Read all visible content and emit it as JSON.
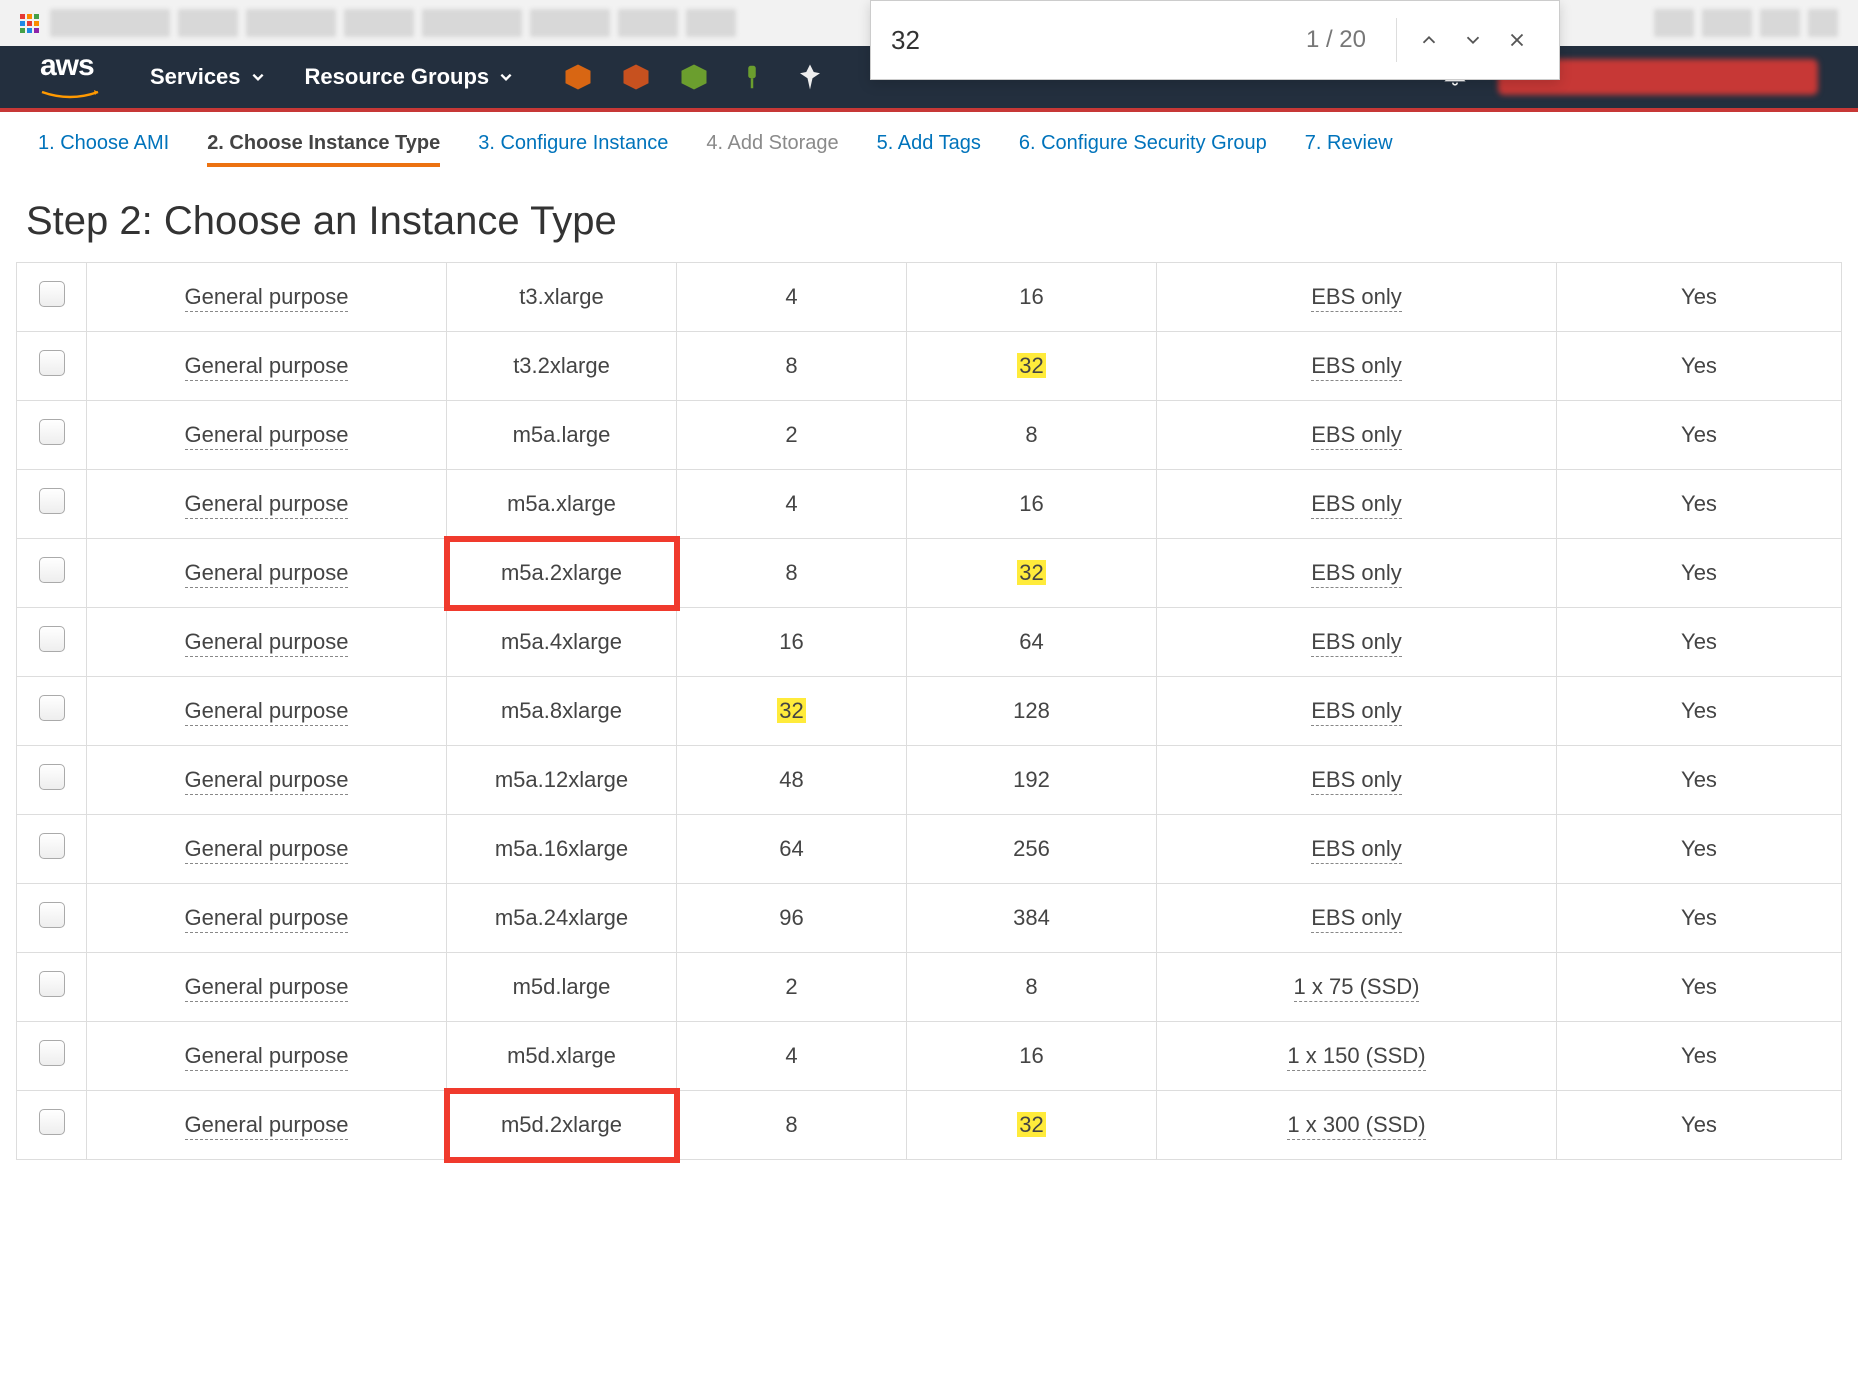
{
  "find": {
    "value": "32",
    "count": "1 / 20"
  },
  "nav": {
    "services": "Services",
    "rg": "Resource Groups"
  },
  "wizard": [
    {
      "label": "1. Choose AMI",
      "state": "link"
    },
    {
      "label": "2. Choose Instance Type",
      "state": "active"
    },
    {
      "label": "3. Configure Instance",
      "state": "link"
    },
    {
      "label": "4. Add Storage",
      "state": "disabled"
    },
    {
      "label": "5. Add Tags",
      "state": "link"
    },
    {
      "label": "6. Configure Security Group",
      "state": "link"
    },
    {
      "label": "7. Review",
      "state": "link"
    }
  ],
  "heading": "Step 2: Choose an Instance Type",
  "rows": [
    {
      "family": "General purpose",
      "type": "t3.xlarge",
      "vcpu": "4",
      "mem": "16",
      "storage": "EBS only",
      "ipv6": "Yes",
      "hl_mem": false,
      "hl_vcpu": false,
      "redbox": false
    },
    {
      "family": "General purpose",
      "type": "t3.2xlarge",
      "vcpu": "8",
      "mem": "32",
      "storage": "EBS only",
      "ipv6": "Yes",
      "hl_mem": true,
      "hl_vcpu": false,
      "redbox": false
    },
    {
      "family": "General purpose",
      "type": "m5a.large",
      "vcpu": "2",
      "mem": "8",
      "storage": "EBS only",
      "ipv6": "Yes",
      "hl_mem": false,
      "hl_vcpu": false,
      "redbox": false
    },
    {
      "family": "General purpose",
      "type": "m5a.xlarge",
      "vcpu": "4",
      "mem": "16",
      "storage": "EBS only",
      "ipv6": "Yes",
      "hl_mem": false,
      "hl_vcpu": false,
      "redbox": false
    },
    {
      "family": "General purpose",
      "type": "m5a.2xlarge",
      "vcpu": "8",
      "mem": "32",
      "storage": "EBS only",
      "ipv6": "Yes",
      "hl_mem": true,
      "hl_vcpu": false,
      "redbox": true
    },
    {
      "family": "General purpose",
      "type": "m5a.4xlarge",
      "vcpu": "16",
      "mem": "64",
      "storage": "EBS only",
      "ipv6": "Yes",
      "hl_mem": false,
      "hl_vcpu": false,
      "redbox": false
    },
    {
      "family": "General purpose",
      "type": "m5a.8xlarge",
      "vcpu": "32",
      "mem": "128",
      "storage": "EBS only",
      "ipv6": "Yes",
      "hl_mem": false,
      "hl_vcpu": true,
      "redbox": false
    },
    {
      "family": "General purpose",
      "type": "m5a.12xlarge",
      "vcpu": "48",
      "mem": "192",
      "storage": "EBS only",
      "ipv6": "Yes",
      "hl_mem": false,
      "hl_vcpu": false,
      "redbox": false
    },
    {
      "family": "General purpose",
      "type": "m5a.16xlarge",
      "vcpu": "64",
      "mem": "256",
      "storage": "EBS only",
      "ipv6": "Yes",
      "hl_mem": false,
      "hl_vcpu": false,
      "redbox": false
    },
    {
      "family": "General purpose",
      "type": "m5a.24xlarge",
      "vcpu": "96",
      "mem": "384",
      "storage": "EBS only",
      "ipv6": "Yes",
      "hl_mem": false,
      "hl_vcpu": false,
      "redbox": false
    },
    {
      "family": "General purpose",
      "type": "m5d.large",
      "vcpu": "2",
      "mem": "8",
      "storage": "1 x 75 (SSD)",
      "ipv6": "Yes",
      "hl_mem": false,
      "hl_vcpu": false,
      "redbox": false
    },
    {
      "family": "General purpose",
      "type": "m5d.xlarge",
      "vcpu": "4",
      "mem": "16",
      "storage": "1 x 150 (SSD)",
      "ipv6": "Yes",
      "hl_mem": false,
      "hl_vcpu": false,
      "redbox": false
    },
    {
      "family": "General purpose",
      "type": "m5d.2xlarge",
      "vcpu": "8",
      "mem": "32",
      "storage": "1 x 300 (SSD)",
      "ipv6": "Yes",
      "hl_mem": true,
      "hl_vcpu": false,
      "redbox": true
    }
  ]
}
